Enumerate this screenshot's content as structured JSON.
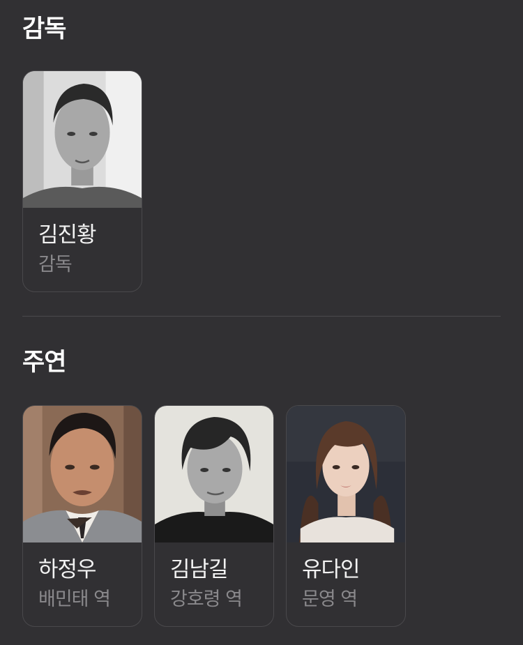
{
  "director_section": {
    "title": "감독",
    "people": [
      {
        "name": "김진황",
        "role": "감독",
        "photo": "director-portrait"
      }
    ]
  },
  "cast_section": {
    "title": "주연",
    "people": [
      {
        "name": "하정우",
        "role": "배민태 역",
        "photo": "actor-portrait-1"
      },
      {
        "name": "김남길",
        "role": "강호령 역",
        "photo": "actor-portrait-2"
      },
      {
        "name": "유다인",
        "role": "문영 역",
        "photo": "actress-portrait-3"
      }
    ]
  },
  "colors": {
    "background": "#313033",
    "card_border": "#4a494c",
    "divider": "#4b4a4d",
    "primary_text": "#f2f2f2",
    "secondary_text": "#8a898c"
  }
}
